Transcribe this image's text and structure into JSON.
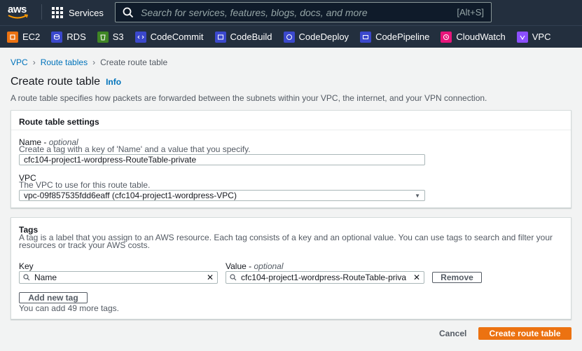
{
  "topnav": {
    "logo_text": "aws",
    "services_label": "Services",
    "search_placeholder": "Search for services, features, blogs, docs, and more",
    "search_shortcut": "[Alt+S]"
  },
  "favorites": [
    {
      "label": "EC2",
      "color": "#ec7211",
      "icon": "ec2-icon"
    },
    {
      "label": "RDS",
      "color": "#3b48cc",
      "icon": "rds-icon"
    },
    {
      "label": "S3",
      "color": "#3f8624",
      "icon": "s3-icon"
    },
    {
      "label": "CodeCommit",
      "color": "#3b48cc",
      "icon": "codecommit-icon"
    },
    {
      "label": "CodeBuild",
      "color": "#3b48cc",
      "icon": "codebuild-icon"
    },
    {
      "label": "CodeDeploy",
      "color": "#3b48cc",
      "icon": "codedeploy-icon"
    },
    {
      "label": "CodePipeline",
      "color": "#3b48cc",
      "icon": "codepipeline-icon"
    },
    {
      "label": "CloudWatch",
      "color": "#e7157b",
      "icon": "cloudwatch-icon"
    },
    {
      "label": "VPC",
      "color": "#8c4fff",
      "icon": "vpc-icon"
    }
  ],
  "breadcrumb": {
    "vpc": "VPC",
    "route_tables": "Route tables",
    "current": "Create route table"
  },
  "page": {
    "title": "Create route table",
    "info": "Info",
    "description": "A route table specifies how packets are forwarded between the subnets within your VPC, the internet, and your VPN connection."
  },
  "settings": {
    "header": "Route table settings",
    "name_label": "Name - ",
    "name_optional": "optional",
    "name_hint": "Create a tag with a key of 'Name' and a value that you specify.",
    "name_value": "cfc104-project1-wordpress-RouteTable-private",
    "vpc_label": "VPC",
    "vpc_hint": "The VPC to use for this route table.",
    "vpc_value": "vpc-09f857535fdd6eaff (cfc104-project1-wordpress-VPC)"
  },
  "tags": {
    "title": "Tags",
    "description": "A tag is a label that you assign to an AWS resource. Each tag consists of a key and an optional value. You can use tags to search and filter your resources or track your AWS costs.",
    "key_label": "Key",
    "value_label": "Value - ",
    "value_optional": "optional",
    "key_value": "Name",
    "value_value": "cfc104-project1-wordpress-RouteTable-priva",
    "remove": "Remove",
    "add_new": "Add new tag",
    "remaining": "You can add 49 more tags."
  },
  "footer": {
    "cancel": "Cancel",
    "create": "Create route table"
  }
}
